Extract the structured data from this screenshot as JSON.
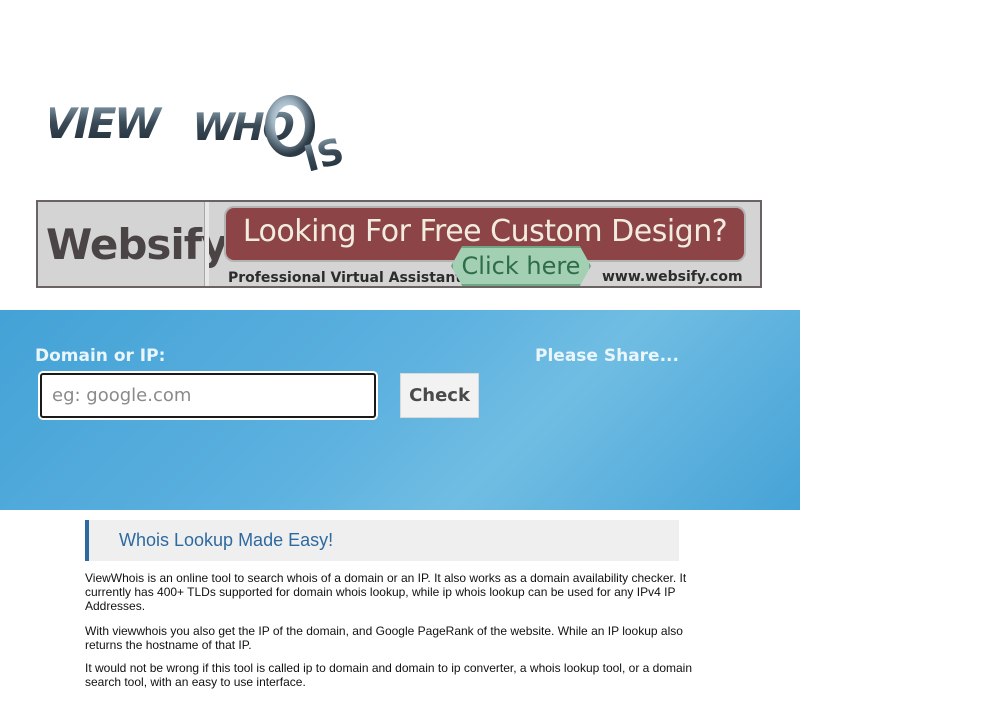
{
  "logo": {
    "alt": "VIEW WHOIS",
    "word1": "VIEW",
    "word2": "WHO",
    "word3": "IS"
  },
  "banner": {
    "brand": "Websify.",
    "headline": "Looking For Free Custom Design?",
    "subtext": "Professional Virtual Assistants",
    "cta": "Click here",
    "url": "www.websify.com"
  },
  "search": {
    "label": "Domain or IP:",
    "placeholder": "eg: google.com",
    "value": "",
    "button_label": "Check",
    "share_label": "Please Share..."
  },
  "content": {
    "section_title": "Whois Lookup Made Easy!",
    "paragraphs": [
      "ViewWhois is an online tool to search whois of a domain or an IP. It also works as a domain availability checker. It currently has 400+ TLDs supported for domain whois lookup, while ip whois lookup can be used for any IPv4 IP Addresses.",
      "With viewwhois you also get the IP of the domain, and Google PageRank of the website. While an IP lookup also returns the hostname of that IP.",
      "It would not be wrong if this tool is called ip to domain and domain to ip converter, a whois lookup tool, or a domain search tool, with an easy to use interface."
    ]
  },
  "colors": {
    "band": "#4aa7d9",
    "accent": "#2d6aa0",
    "banner_pill": "#8c4446",
    "cta": "#a3cfb2"
  }
}
